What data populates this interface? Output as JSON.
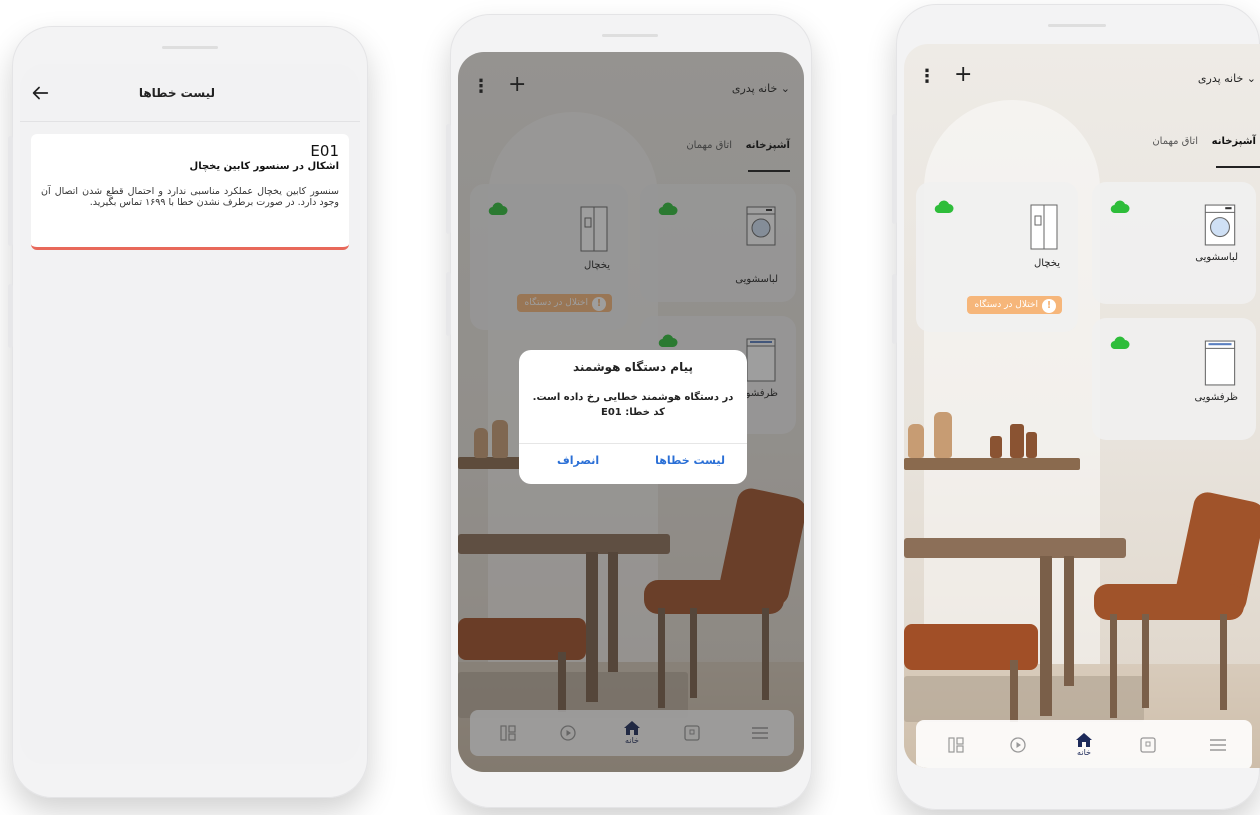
{
  "screen1": {
    "title": "لیست خطاها",
    "error": {
      "code": "E01",
      "title": "اشکال در سنسور کابین یخچال",
      "description": "سنسور کابین یخچال عملکرد مناسبی ندارد و احتمال قطع شدن اتصال آن وجود دارد. در صورت برطرف نشدن خطا با ۱۶۹۹ تماس بگیرید."
    }
  },
  "screen2": {
    "home": "خانه پدری",
    "tabs": [
      "آشپزخانه",
      "اتاق مهمان"
    ],
    "devices": [
      "لباسشویی",
      "یخچال",
      "ظرفشویی"
    ],
    "warning": "اختلال در دستگاه",
    "dialog": {
      "title": "پیام دستگاه هوشمند",
      "message": "در دستگاه هوشمند خطایی رخ داده است.",
      "code_line": "کد خطا: E01",
      "btn_errors": "لیست خطاها",
      "btn_cancel": "انصراف"
    },
    "nav_home_label": "خانه"
  },
  "screen3": {
    "home": "خانه پدری",
    "tabs": [
      "آشپزخانه",
      "اتاق مهمان"
    ],
    "devices": [
      "لباسشویی",
      "یخچال",
      "ظرفشویی"
    ],
    "warning": "اختلال در دستگاه",
    "nav_home_label": "خانه"
  },
  "colors": {
    "online": "#2ebd3a",
    "warning": "#f6b67a",
    "error_accent": "#e8685a",
    "link": "#2a6fd6",
    "nav_active": "#1d2a5a"
  }
}
